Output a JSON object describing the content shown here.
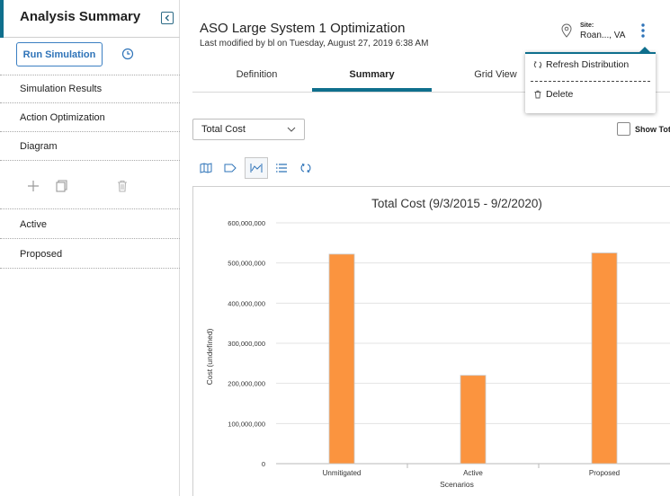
{
  "sidebar": {
    "title": "Analysis Summary",
    "run_button": "Run Simulation",
    "items": [
      {
        "label": "Simulation Results"
      },
      {
        "label": "Action Optimization"
      },
      {
        "label": "Diagram"
      }
    ],
    "scenarios": [
      {
        "label": "Active"
      },
      {
        "label": "Proposed"
      }
    ]
  },
  "header": {
    "title": "ASO Large System 1 Optimization",
    "subtitle": "Last modified by bl on Tuesday, August 27, 2019 6:38 AM",
    "site_label": "Site:",
    "site_value": "Roan..., VA"
  },
  "tabs": [
    {
      "label": "Definition",
      "active": false
    },
    {
      "label": "Summary",
      "active": true
    },
    {
      "label": "Grid View",
      "active": false
    }
  ],
  "menu": {
    "items": [
      {
        "label": "Refresh Distribution",
        "icon": "refresh-icon"
      },
      {
        "label": "Delete",
        "icon": "trash-icon"
      }
    ]
  },
  "controls": {
    "select_value": "Total Cost",
    "show_total_label": "Show Total",
    "show_total_checked": false
  },
  "colors": {
    "accent": "#0f6f8d",
    "bar": "#fb943f",
    "link": "#2e73b8"
  },
  "chart_data": {
    "type": "bar",
    "title": "Total Cost (9/3/2015 - 9/2/2020)",
    "xlabel": "Scenarios",
    "ylabel": "Cost (undefined)",
    "categories": [
      "Unmitigated",
      "Active",
      "Proposed"
    ],
    "values": [
      522000000,
      220000000,
      525000000
    ],
    "ylim": [
      0,
      600000000
    ],
    "yticks": [
      0,
      100000000,
      200000000,
      300000000,
      400000000,
      500000000,
      600000000
    ],
    "ytick_labels": [
      "0",
      "100,000,000",
      "200,000,000",
      "300,000,000",
      "400,000,000",
      "500,000,000",
      "600,000,000"
    ],
    "grid": true,
    "legend": "none"
  }
}
